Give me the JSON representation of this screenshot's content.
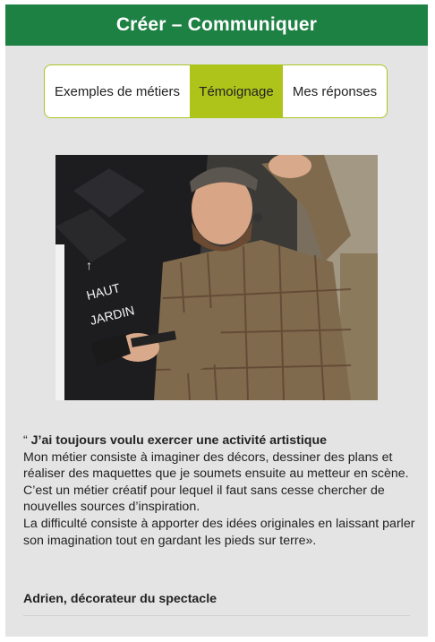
{
  "header": {
    "title": "Créer – Communiquer"
  },
  "tabs": [
    {
      "label": "Exemples de métiers",
      "active": false
    },
    {
      "label": "Témoignage",
      "active": true
    },
    {
      "label": "Mes réponses",
      "active": false
    }
  ],
  "photo": {
    "sign_text_1": "HAUT",
    "sign_text_2": "JARDIN"
  },
  "testimony": {
    "quote_open": "“ ",
    "headline": "J’ai toujours voulu exercer une activité artistique",
    "lines": [
      "Mon métier consiste à imaginer des décors, dessiner des plans et réaliser des maquettes que je soumets ensuite au metteur en scène.",
      "C’est un métier créatif pour lequel il faut sans cesse chercher de nouvelles sources d’inspiration.",
      "La difficulté consiste à apporter des idées originales en laissant parler son imagination tout en gardant les pieds sur terre»."
    ],
    "signature": "Adrien, décorateur du spectacle"
  },
  "colors": {
    "header_bg": "#1e8144",
    "active_tab": "#aec41a",
    "tab_border": "#a8c622",
    "panel_bg": "#e4e4e4"
  }
}
